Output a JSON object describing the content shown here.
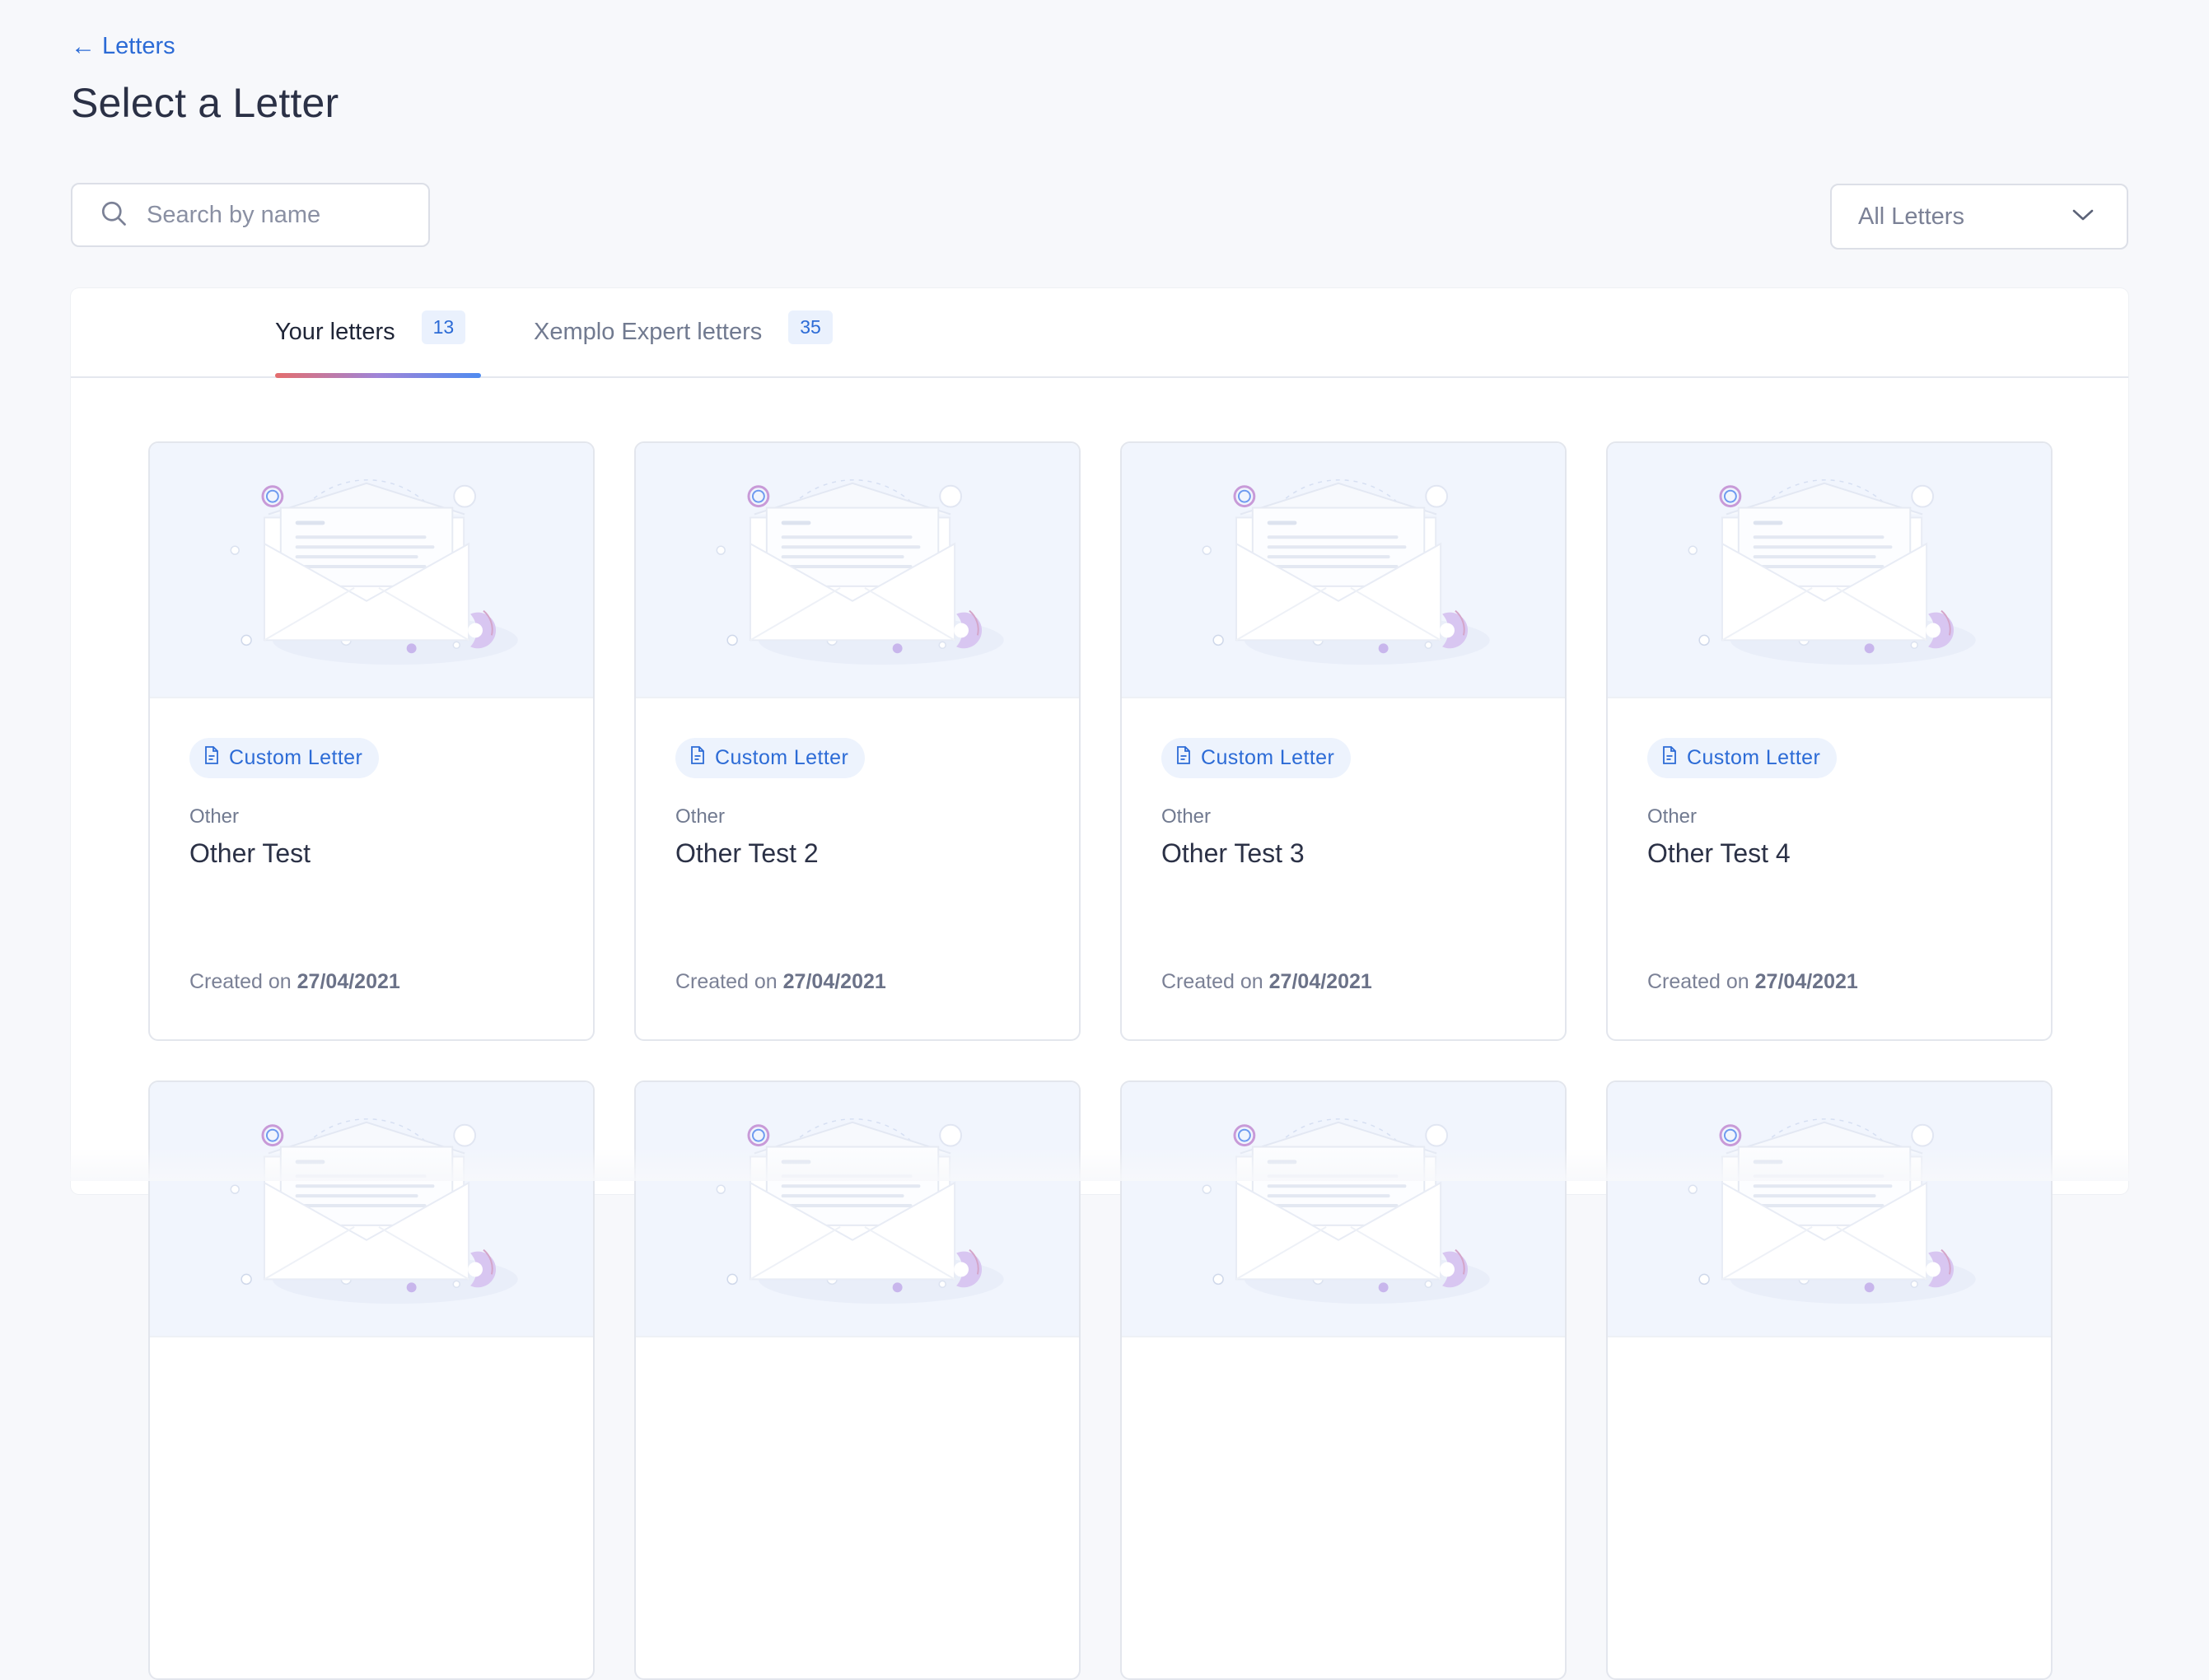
{
  "breadcrumb": {
    "back_label": "Letters"
  },
  "page": {
    "title": "Select a Letter"
  },
  "search": {
    "placeholder": "Search by name",
    "value": ""
  },
  "filter": {
    "selected": "All Letters"
  },
  "tabs": [
    {
      "label": "Your letters",
      "count": "13",
      "active": true
    },
    {
      "label": "Xemplo Expert letters",
      "count": "35",
      "active": false
    }
  ],
  "cards": [
    {
      "badge": "Custom Letter",
      "category": "Other",
      "title": "Other Test",
      "created_prefix": "Created on",
      "created_date": "27/04/2021"
    },
    {
      "badge": "Custom Letter",
      "category": "Other",
      "title": "Other Test 2",
      "created_prefix": "Created on",
      "created_date": "27/04/2021"
    },
    {
      "badge": "Custom Letter",
      "category": "Other",
      "title": "Other Test 3",
      "created_prefix": "Created on",
      "created_date": "27/04/2021"
    },
    {
      "badge": "Custom Letter",
      "category": "Other",
      "title": "Other Test 4",
      "created_prefix": "Created on",
      "created_date": "27/04/2021"
    }
  ],
  "icons": {
    "back": "arrow-left-icon",
    "search": "search-icon",
    "dropdown": "chevron-down-icon",
    "badge": "document-icon",
    "illustration": "envelope-illustration"
  },
  "colors": {
    "accent": "#2c6bd6",
    "background": "#f7f8fb",
    "card_illustration_bg": "#f1f5fd",
    "badge_bg": "#edf3fd"
  }
}
